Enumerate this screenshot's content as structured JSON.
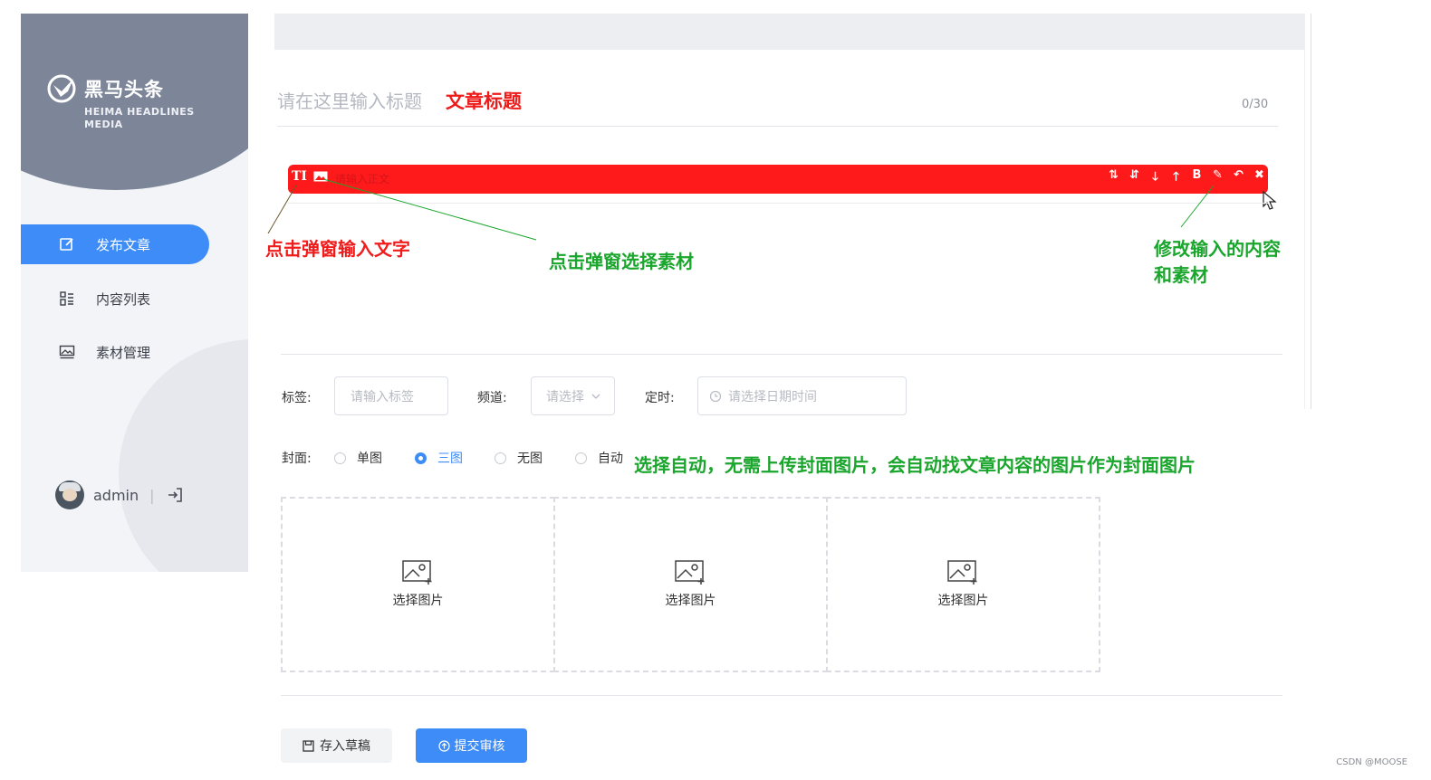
{
  "app": {
    "logo_title": "黑马头条",
    "logo_subtitle": "HEIMA HEADLINES MEDIA"
  },
  "sidebar": {
    "items": [
      {
        "label": "发布文章",
        "icon": "edit-icon",
        "active": true
      },
      {
        "label": "内容列表",
        "icon": "list-icon",
        "active": false
      },
      {
        "label": "素材管理",
        "icon": "image-icon",
        "active": false
      }
    ],
    "user": {
      "name": "admin",
      "separator": "|"
    }
  },
  "editor": {
    "title_placeholder": "请在这里输入标题",
    "title_annotation": "文章标题",
    "title_counter": "0/30",
    "toolbar_left": [
      "TI",
      "image"
    ],
    "content_placeholder": "请输入正文",
    "toolbar_right_icons": [
      "sort-asc-icon",
      "sort-desc-icon",
      "arrow-down-icon",
      "arrow-up-icon",
      "bold-icon",
      "edit-icon",
      "undo-icon",
      "close-icon"
    ],
    "toolbar_right_glyphs": [
      "⇅",
      "⇵",
      "🡓",
      "🡑",
      "B",
      "✎",
      "↶",
      "✖"
    ]
  },
  "annotations": {
    "text_popup": "点击弹窗输入文字",
    "material_popup": "点击弹窗选择素材",
    "modify_line1": "修改输入的内容",
    "modify_line2": "和素材",
    "cover_auto": "选择自动，无需上传封面图片，会自动找文章内容的图片作为封面图片"
  },
  "form": {
    "tag_label": "标签:",
    "tag_placeholder": "请输入标签",
    "channel_label": "频道:",
    "channel_placeholder": "请选择",
    "schedule_label": "定时:",
    "schedule_placeholder": "请选择日期时间",
    "cover_label": "封面:",
    "cover_options": [
      {
        "label": "单图",
        "selected": false
      },
      {
        "label": "三图",
        "selected": true
      },
      {
        "label": "无图",
        "selected": false
      },
      {
        "label": "自动",
        "selected": false
      }
    ],
    "upload_label": "选择图片"
  },
  "actions": {
    "draft": "存入草稿",
    "submit": "提交审核"
  },
  "colors": {
    "primary": "#3e8cf7",
    "annotation_red": "#f01c1c",
    "annotation_green": "#1aa52c",
    "toolbar_red": "#fe1a1a",
    "sidebar_blob": "#7d8599"
  },
  "watermark": "CSDN @MOOSE"
}
